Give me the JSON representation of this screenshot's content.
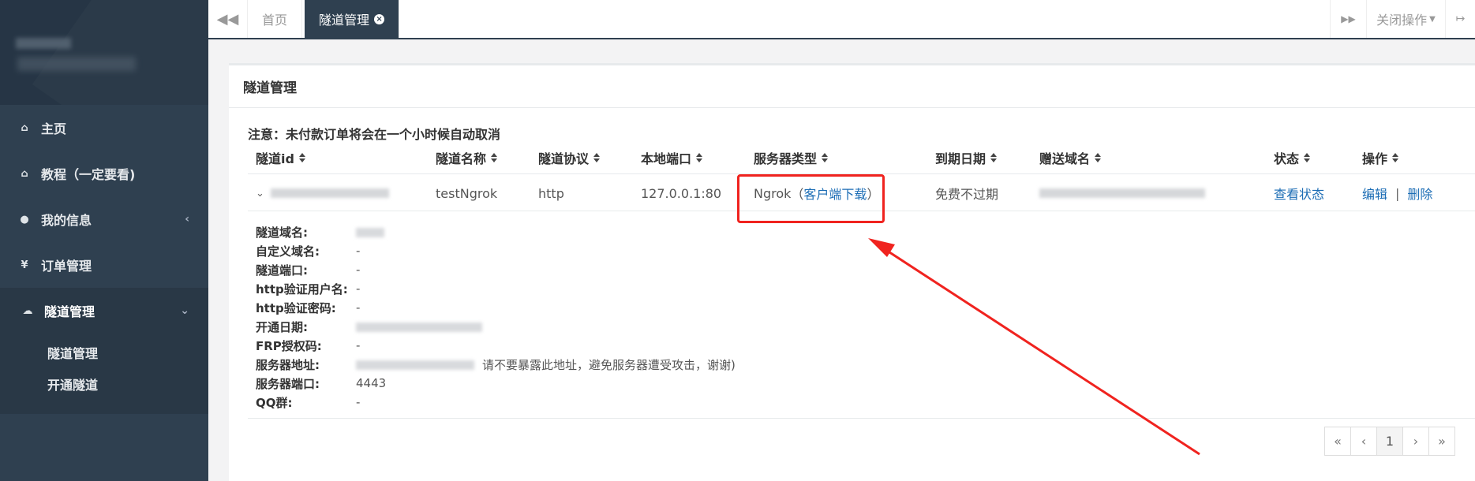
{
  "sidebar": {
    "items": [
      {
        "label": "主页",
        "icon": "home-icon"
      },
      {
        "label": "教程（一定要看)",
        "icon": "home-icon"
      },
      {
        "label": "我的信息",
        "icon": "user-icon"
      },
      {
        "label": "订单管理",
        "icon": "yen-icon"
      },
      {
        "label": "隧道管理",
        "icon": "cloud-icon"
      }
    ],
    "subitems": [
      {
        "label": "隧道管理"
      },
      {
        "label": "开通隧道"
      }
    ]
  },
  "topbar": {
    "tabs": [
      {
        "label": "首页"
      },
      {
        "label": "隧道管理"
      }
    ],
    "close_ops": "关闭操作"
  },
  "panel": {
    "title": "隧道管理",
    "notice": "注意：未付款订单将会在一个小时候自动取消"
  },
  "table": {
    "headers": [
      "隧道id",
      "隧道名称",
      "隧道协议",
      "本地端口",
      "服务器类型",
      "到期日期",
      "赠送域名",
      "状态",
      "操作"
    ],
    "row": {
      "name": "testNgrok",
      "protocol": "http",
      "local_port": "127.0.0.1:80",
      "server_type": "Ngrok",
      "download_open": "（",
      "download_link": "客户端下载",
      "download_close": "）",
      "expiry": "免费不过期",
      "status_link": "查看状态",
      "edit": "编辑",
      "sep": "|",
      "delete": "删除"
    }
  },
  "details": [
    {
      "label": "隧道域名:",
      "value": ""
    },
    {
      "label": "自定义域名:",
      "value": "-"
    },
    {
      "label": "隧道端口:",
      "value": "-"
    },
    {
      "label": "http验证用户名:",
      "value": "-"
    },
    {
      "label": "http验证密码:",
      "value": "-"
    },
    {
      "label": "开通日期:",
      "value": ""
    },
    {
      "label": "FRP授权码:",
      "value": "-"
    },
    {
      "label": "服务器地址:",
      "value": "请不要暴露此地址，避免服务器遭受攻击，谢谢)"
    },
    {
      "label": "服务器端口:",
      "value": "4443"
    },
    {
      "label": "QQ群:",
      "value": "-"
    }
  ],
  "pagination": {
    "first": "«",
    "prev": "‹",
    "page": "1",
    "next": "›",
    "last": "»"
  },
  "colors": {
    "sidebar_bg": "#2f4050",
    "accent_link": "#1c6db5",
    "annotation_red": "#f0231f"
  }
}
